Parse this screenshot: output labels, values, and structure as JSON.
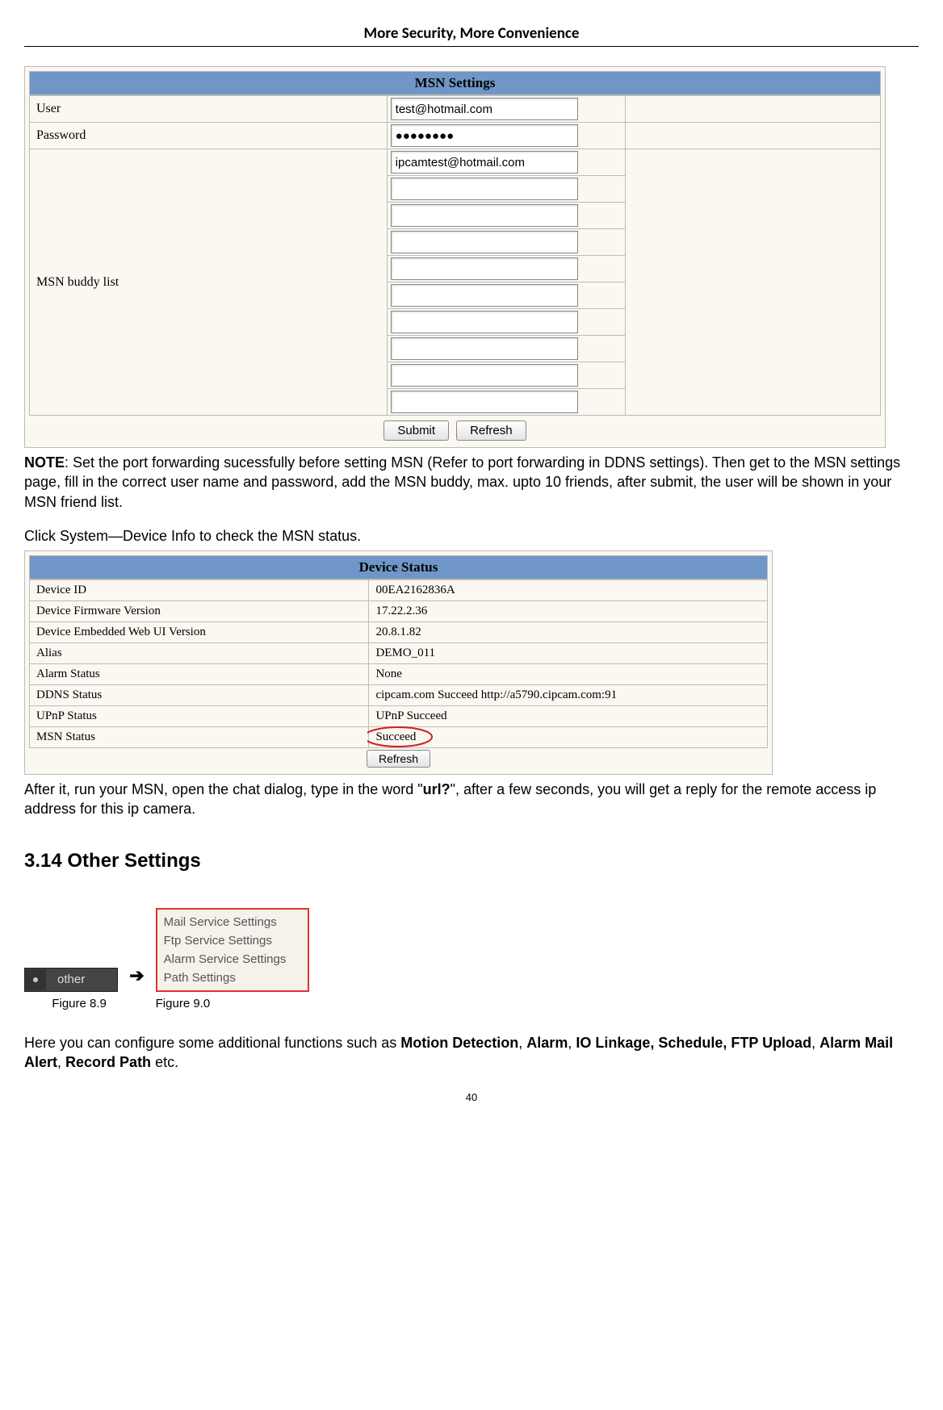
{
  "header": {
    "title": "More Security, More Convenience"
  },
  "msn_panel": {
    "title": "MSN Settings",
    "user_label": "User",
    "user_value": "test@hotmail.com",
    "password_label": "Password",
    "password_value": "●●●●●●●●",
    "buddy_label": "MSN buddy list",
    "buddy": [
      "ipcamtest@hotmail.com",
      "",
      "",
      "",
      "",
      "",
      "",
      "",
      "",
      ""
    ],
    "submit": "Submit",
    "refresh": "Refresh"
  },
  "note": {
    "label": "NOTE",
    "body": ": Set the port forwarding sucessfully before setting MSN (Refer to port forwarding in DDNS settings). Then get to the MSN settings page, fill in the correct user name and password, add the MSN buddy, max. upto 10 friends, after submit, the user will be shown in your MSN friend list."
  },
  "click_text": "Click System—Device Info to check the MSN status.",
  "status_panel": {
    "title": "Device Status",
    "rows": [
      {
        "k": "Device ID",
        "v": "00EA2162836A"
      },
      {
        "k": "Device Firmware Version",
        "v": "17.22.2.36"
      },
      {
        "k": "Device Embedded Web UI Version",
        "v": "20.8.1.82"
      },
      {
        "k": "Alias",
        "v": "DEMO_011"
      },
      {
        "k": "Alarm Status",
        "v": "None"
      },
      {
        "k": "DDNS Status",
        "v": "cipcam.com  Succeed  http://a5790.cipcam.com:91"
      },
      {
        "k": "UPnP Status",
        "v": "UPnP Succeed"
      },
      {
        "k": "MSN Status",
        "v": "Succeed"
      }
    ],
    "refresh": "Refresh"
  },
  "after_text_1": "After it, run your MSN, open the chat dialog, type in the word \"",
  "after_text_bold": "url?",
  "after_text_2": "\", after a few seconds, you will get a reply for the remote access ip address for this ip camera.",
  "section_heading": "3.14 Other Settings",
  "other_button": "other",
  "arrow": "➔",
  "menu_items": [
    "Mail Service Settings",
    "Ftp Service Settings",
    "Alarm Service Settings",
    "Path Settings"
  ],
  "fig_a": "Figure 8.9",
  "fig_b": "Figure 9.0",
  "footer_1": "Here you can configure some additional functions such as ",
  "footer_bold_1": "Motion Detection",
  "footer_bold_2": "Alarm",
  "footer_bold_3": "IO Linkage, Schedule, FTP Upload",
  "footer_bold_4": "Alarm Mail Alert",
  "footer_bold_5": "Record Path",
  "footer_etc": " etc.",
  "page_number": "40"
}
